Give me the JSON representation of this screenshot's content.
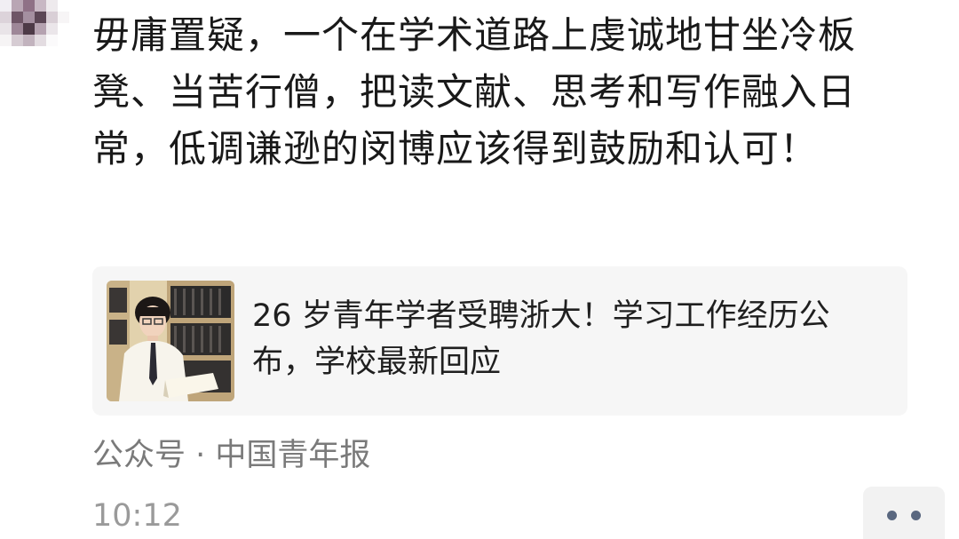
{
  "post": {
    "text": "毋庸置疑，一个在学术道路上虔诚地甘坐冷板凳、当苦行僧，把读文献、思考和写作融入日常，低调谦逊的闵博应该得到鼓励和认可！"
  },
  "shared_article": {
    "title": "26 岁青年学者受聘浙大！学习工作经历公布，学校最新回应",
    "thumbnail": "young-scholar-photo-with-bookshelf"
  },
  "source": {
    "label": "公众号 · 中国青年报"
  },
  "meta": {
    "time": "10:12"
  },
  "icons": {
    "more": "more-dots-icon",
    "avatar": "pixelated-avatar"
  },
  "colors": {
    "text": "#191919",
    "secondary_text": "#7a7a7a",
    "card_background": "#f6f6f6",
    "action_dots": "#59677f"
  }
}
